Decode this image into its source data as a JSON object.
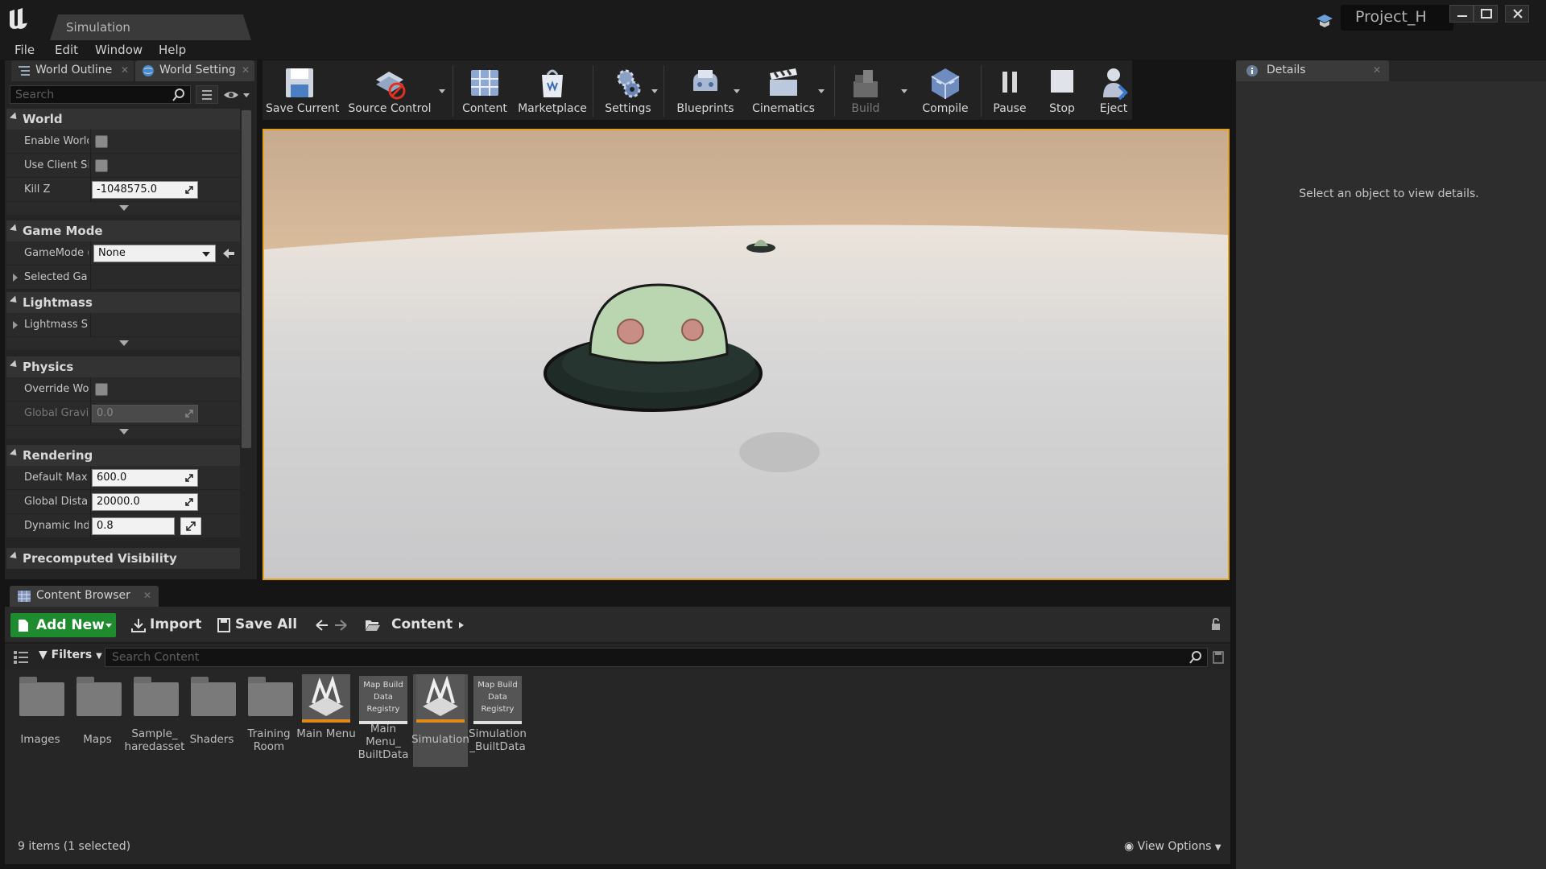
{
  "window": {
    "tab_title": "Simulation",
    "project_name": "Project_H"
  },
  "menu": [
    "File",
    "Edit",
    "Window",
    "Help"
  ],
  "left_panel": {
    "tabs": [
      "World Outline",
      "World Setting"
    ],
    "search_placeholder": "Search",
    "categories": {
      "world": {
        "title": "World",
        "rows": [
          {
            "label": "Enable World",
            "type": "checkbox",
            "checked": false
          },
          {
            "label": "Use Client Si",
            "type": "checkbox",
            "checked": false
          },
          {
            "label": "Kill Z",
            "type": "number",
            "value": "-1048575.0"
          }
        ]
      },
      "game_mode": {
        "title": "Game Mode",
        "gamemode_label": "GameMode (",
        "gamemode_value": "None",
        "selected_label": "Selected Ga"
      },
      "lightmass": {
        "title": "Lightmass",
        "row_label": "Lightmass S"
      },
      "physics": {
        "title": "Physics",
        "override_label": "Override Wor",
        "gravity_label": "Global Gravit",
        "gravity_value": "0.0"
      },
      "rendering": {
        "title": "Rendering",
        "rows": [
          {
            "label": "Default Max",
            "value": "600.0"
          },
          {
            "label": "Global Distar",
            "value": "20000.0"
          },
          {
            "label": "Dynamic Indi",
            "value": "0.8"
          }
        ]
      },
      "precomputed": {
        "title": "Precomputed Visibility"
      }
    }
  },
  "toolbar": {
    "buttons": [
      {
        "label": "Save Current",
        "icon": "save-icon"
      },
      {
        "label": "Source Control",
        "icon": "source-control-icon"
      },
      {
        "label": "Content",
        "icon": "content-icon"
      },
      {
        "label": "Marketplace",
        "icon": "marketplace-icon"
      },
      {
        "label": "Settings",
        "icon": "settings-icon"
      },
      {
        "label": "Blueprints",
        "icon": "blueprints-icon"
      },
      {
        "label": "Cinematics",
        "icon": "cinematics-icon"
      },
      {
        "label": "Build",
        "icon": "build-icon"
      },
      {
        "label": "Compile",
        "icon": "compile-icon"
      },
      {
        "label": "Pause",
        "icon": "pause-icon"
      },
      {
        "label": "Stop",
        "icon": "stop-icon"
      },
      {
        "label": "Eject",
        "icon": "eject-icon"
      }
    ]
  },
  "details": {
    "tab": "Details",
    "empty_message": "Select an object to view details."
  },
  "content_browser": {
    "tab": "Content Browser",
    "add_new": "Add New",
    "import": "Import",
    "save_all": "Save All",
    "path": "Content",
    "filters": "Filters",
    "search_placeholder": "Search Content",
    "assets": [
      {
        "name": "Images",
        "kind": "folder"
      },
      {
        "name": "Maps",
        "kind": "folder"
      },
      {
        "name": "Sample_ haredasset",
        "kind": "folder"
      },
      {
        "name": "Shaders",
        "kind": "folder"
      },
      {
        "name": "Training Room",
        "kind": "folder"
      },
      {
        "name": "Main Menu",
        "kind": "map"
      },
      {
        "name": "Main Menu_ BuiltData",
        "kind": "map-build-data",
        "thumb_text": "Map Build Data Registry"
      },
      {
        "name": "Simulation",
        "kind": "map",
        "selected": true
      },
      {
        "name": "Simulation _BuiltData",
        "kind": "map-build-data",
        "thumb_text": "Map Build Data Registry"
      }
    ],
    "status": "9 items (1 selected)",
    "view_options": "View Options"
  }
}
